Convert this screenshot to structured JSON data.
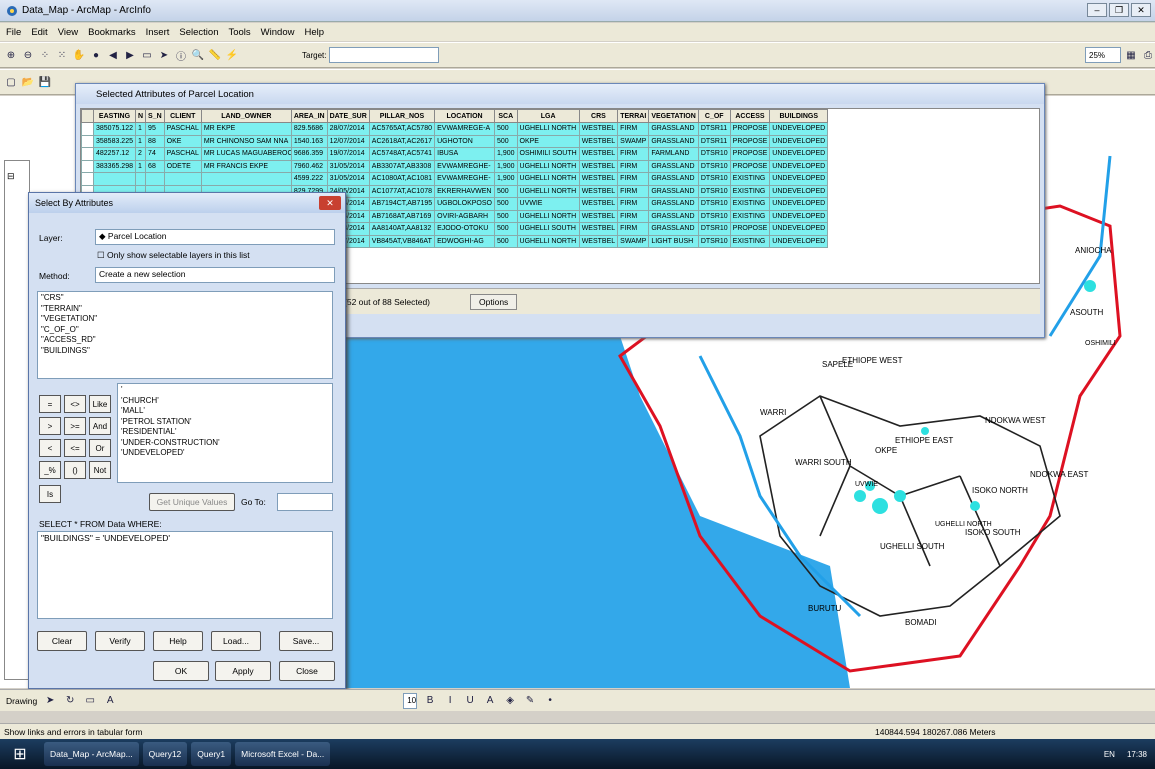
{
  "window": {
    "title": "Data_Map - ArcMap - ArcInfo"
  },
  "menu": [
    "File",
    "Edit",
    "View",
    "Bookmarks",
    "Insert",
    "Selection",
    "Tools",
    "Window",
    "Help"
  ],
  "toolbar": {
    "target_label": "Target:",
    "zoom": "25%"
  },
  "attr_window": {
    "title": "Selected Attributes of Parcel Location",
    "columns": [
      "EASTING",
      "N",
      "S_N",
      "CLIENT",
      "LAND_OWNER",
      "AREA_IN",
      "DATE_SUR",
      "PILLAR_NOS",
      "LOCATION",
      "SCA",
      "LGA",
      "CRS",
      "TERRAI",
      "VEGETATION",
      "C_OF",
      "ACCESS",
      "BUILDINGS"
    ],
    "rows": [
      [
        "385075.122",
        "1",
        "95",
        "PASCHAL",
        "MR EKPE",
        "829.5686",
        "28/07/2014",
        "AC5765AT,AC5780",
        "EVWAMREGE-A",
        "500",
        "UGHELLI NORTH",
        "WESTBEL",
        "FIRM",
        "GRASSLAND",
        "DTSR11",
        "PROPOSE",
        "UNDEVELOPED"
      ],
      [
        "358583.225",
        "1",
        "88",
        "OKE",
        "MR CHINONSO SAM NNA",
        "1540.163",
        "12/07/2014",
        "AC2618AT,AC2617",
        "UGHOTON",
        "500",
        "OKPE",
        "WESTBEL",
        "SWAMP",
        "GRASSLAND",
        "DTSR11",
        "PROPOSE",
        "UNDEVELOPED"
      ],
      [
        "482257.12",
        "2",
        "74",
        "PASCHAL",
        "MR LUCAS MAGUABEROC",
        "9686.359",
        "19/07/2014",
        "AC5748AT,AC5741",
        "IBUSA",
        "1,900",
        "OSHIMILI SOUTH",
        "WESTBEL",
        "FIRM",
        "FARMLAND",
        "DTSR10",
        "PROPOSE",
        "UNDEVELOPED"
      ],
      [
        "383365.298",
        "1",
        "68",
        "ODETE",
        "MR FRANCIS EKPE",
        "7960.462",
        "31/05/2014",
        "AB3307AT,AB3308",
        "EVWAMREGHE-",
        "1,900",
        "UGHELLI NORTH",
        "WESTBEL",
        "FIRM",
        "GRASSLAND",
        "DTSR10",
        "PROPOSE",
        "UNDEVELOPED"
      ],
      [
        "",
        "",
        "",
        "",
        "",
        "4599.222",
        "31/05/2014",
        "AC1080AT,AC1081",
        "EVWAMREGHE-",
        "1,900",
        "UGHELLI NORTH",
        "WESTBEL",
        "FIRM",
        "GRASSLAND",
        "DTSR10",
        "EXISTING",
        "UNDEVELOPED"
      ],
      [
        "",
        "",
        "",
        "",
        "",
        "829.7299",
        "24/05/2014",
        "AC1077AT,AC1078",
        "EKRERHAVWEN",
        "500",
        "UGHELLI NORTH",
        "WESTBEL",
        "FIRM",
        "GRASSLAND",
        "DTSR10",
        "EXISTING",
        "UNDEVELOPED"
      ],
      [
        "",
        "",
        "",
        "",
        "",
        "460.553",
        "03/04/2014",
        "AB7194CT,AB7195",
        "UGBOLOKPOSO",
        "500",
        "UVWIE",
        "WESTBEL",
        "FIRM",
        "GRASSLAND",
        "DTSR10",
        "EXISTING",
        "UNDEVELOPED"
      ],
      [
        "",
        "",
        "",
        "",
        "",
        "838.2033",
        "15/04/2014",
        "AB7168AT,AB7169",
        "OVIRI-AGBARH",
        "500",
        "UGHELLI NORTH",
        "WESTBEL",
        "FIRM",
        "GRASSLAND",
        "DTSR10",
        "EXISTING",
        "UNDEVELOPED"
      ],
      [
        "",
        "",
        "",
        "",
        "",
        "1224.658",
        "30/03/2014",
        "AA8140AT,AA8132",
        "EJODO-OTOKU",
        "500",
        "UGHELLI SOUTH",
        "WESTBEL",
        "FIRM",
        "GRASSLAND",
        "DTSR10",
        "PROPOSE",
        "UNDEVELOPED"
      ],
      [
        "",
        "",
        "",
        "",
        "",
        "7780.434",
        "27/07/2014",
        "VB845AT,VB846AT",
        "EDWOGHI-AG",
        "500",
        "UGHELLI NORTH",
        "WESTBEL",
        "SWAMP",
        "LIGHT BUSH",
        "DTSR10",
        "EXISTING",
        "UNDEVELOPED"
      ]
    ],
    "records_text": "Records (52 out of 88 Selected)",
    "options_label": "Options",
    "selected_label": "ected"
  },
  "dialog": {
    "title": "Select By Attributes",
    "layer_label": "Layer:",
    "layer_value": "Parcel Location",
    "only_selectable": "Only show selectable layers in this list",
    "method_label": "Method:",
    "method_value": "Create a new selection",
    "fields": [
      "\"CRS\"",
      "\"TERRAIN\"",
      "\"VEGETATION\"",
      "\"C_OF_O\"",
      "\"ACCESS_RD\"",
      "\"BUILDINGS\""
    ],
    "operators": [
      "=",
      "<>",
      "Like",
      ">",
      ">=",
      "And",
      "<",
      "<=",
      "Or",
      "_%",
      "()",
      "Not",
      "Is"
    ],
    "values": [
      "'",
      "'CHURCH'",
      "'MALL'",
      "'PETROL STATION'",
      "'RESIDENTIAL'",
      "'UNDER-CONSTRUCTION'",
      "'UNDEVELOPED'"
    ],
    "get_unique": "Get Unique Values",
    "goto_label": "Go To:",
    "select_from": "SELECT * FROM Data WHERE:",
    "query": "\"BUILDINGS\" = 'UNDEVELOPED'",
    "buttons": [
      "Clear",
      "Verify",
      "Help",
      "Load...",
      "Save..."
    ],
    "ok": "OK",
    "apply": "Apply",
    "close": "Close"
  },
  "map_labels": [
    "SAPELE",
    "OKPE",
    "ETHIOPE WEST",
    "ETHIOPE EAST",
    "UVWIE",
    "WARRI SOUTH",
    "UGHELLI NORTH",
    "UGHELLI SOUTH",
    "BURUTU",
    "BOMADI",
    "NDOKWA WEST",
    "NDOKWA EAST",
    "ISOKO NORTH",
    "ISOKO SOUTH",
    "ANIOCHA",
    "WARRI",
    "OSHIMILI",
    "ASOUTH"
  ],
  "drawing_label": "Drawing",
  "font_size": "10",
  "status_text": "Show links and errors in tabular form",
  "coords": "140844.594  180267.086 Meters",
  "taskbar": [
    "Data_Map - ArcMap...",
    "Query12",
    "Query1",
    "Microsoft Excel - Da..."
  ],
  "clock": "17:38",
  "lang": "EN"
}
